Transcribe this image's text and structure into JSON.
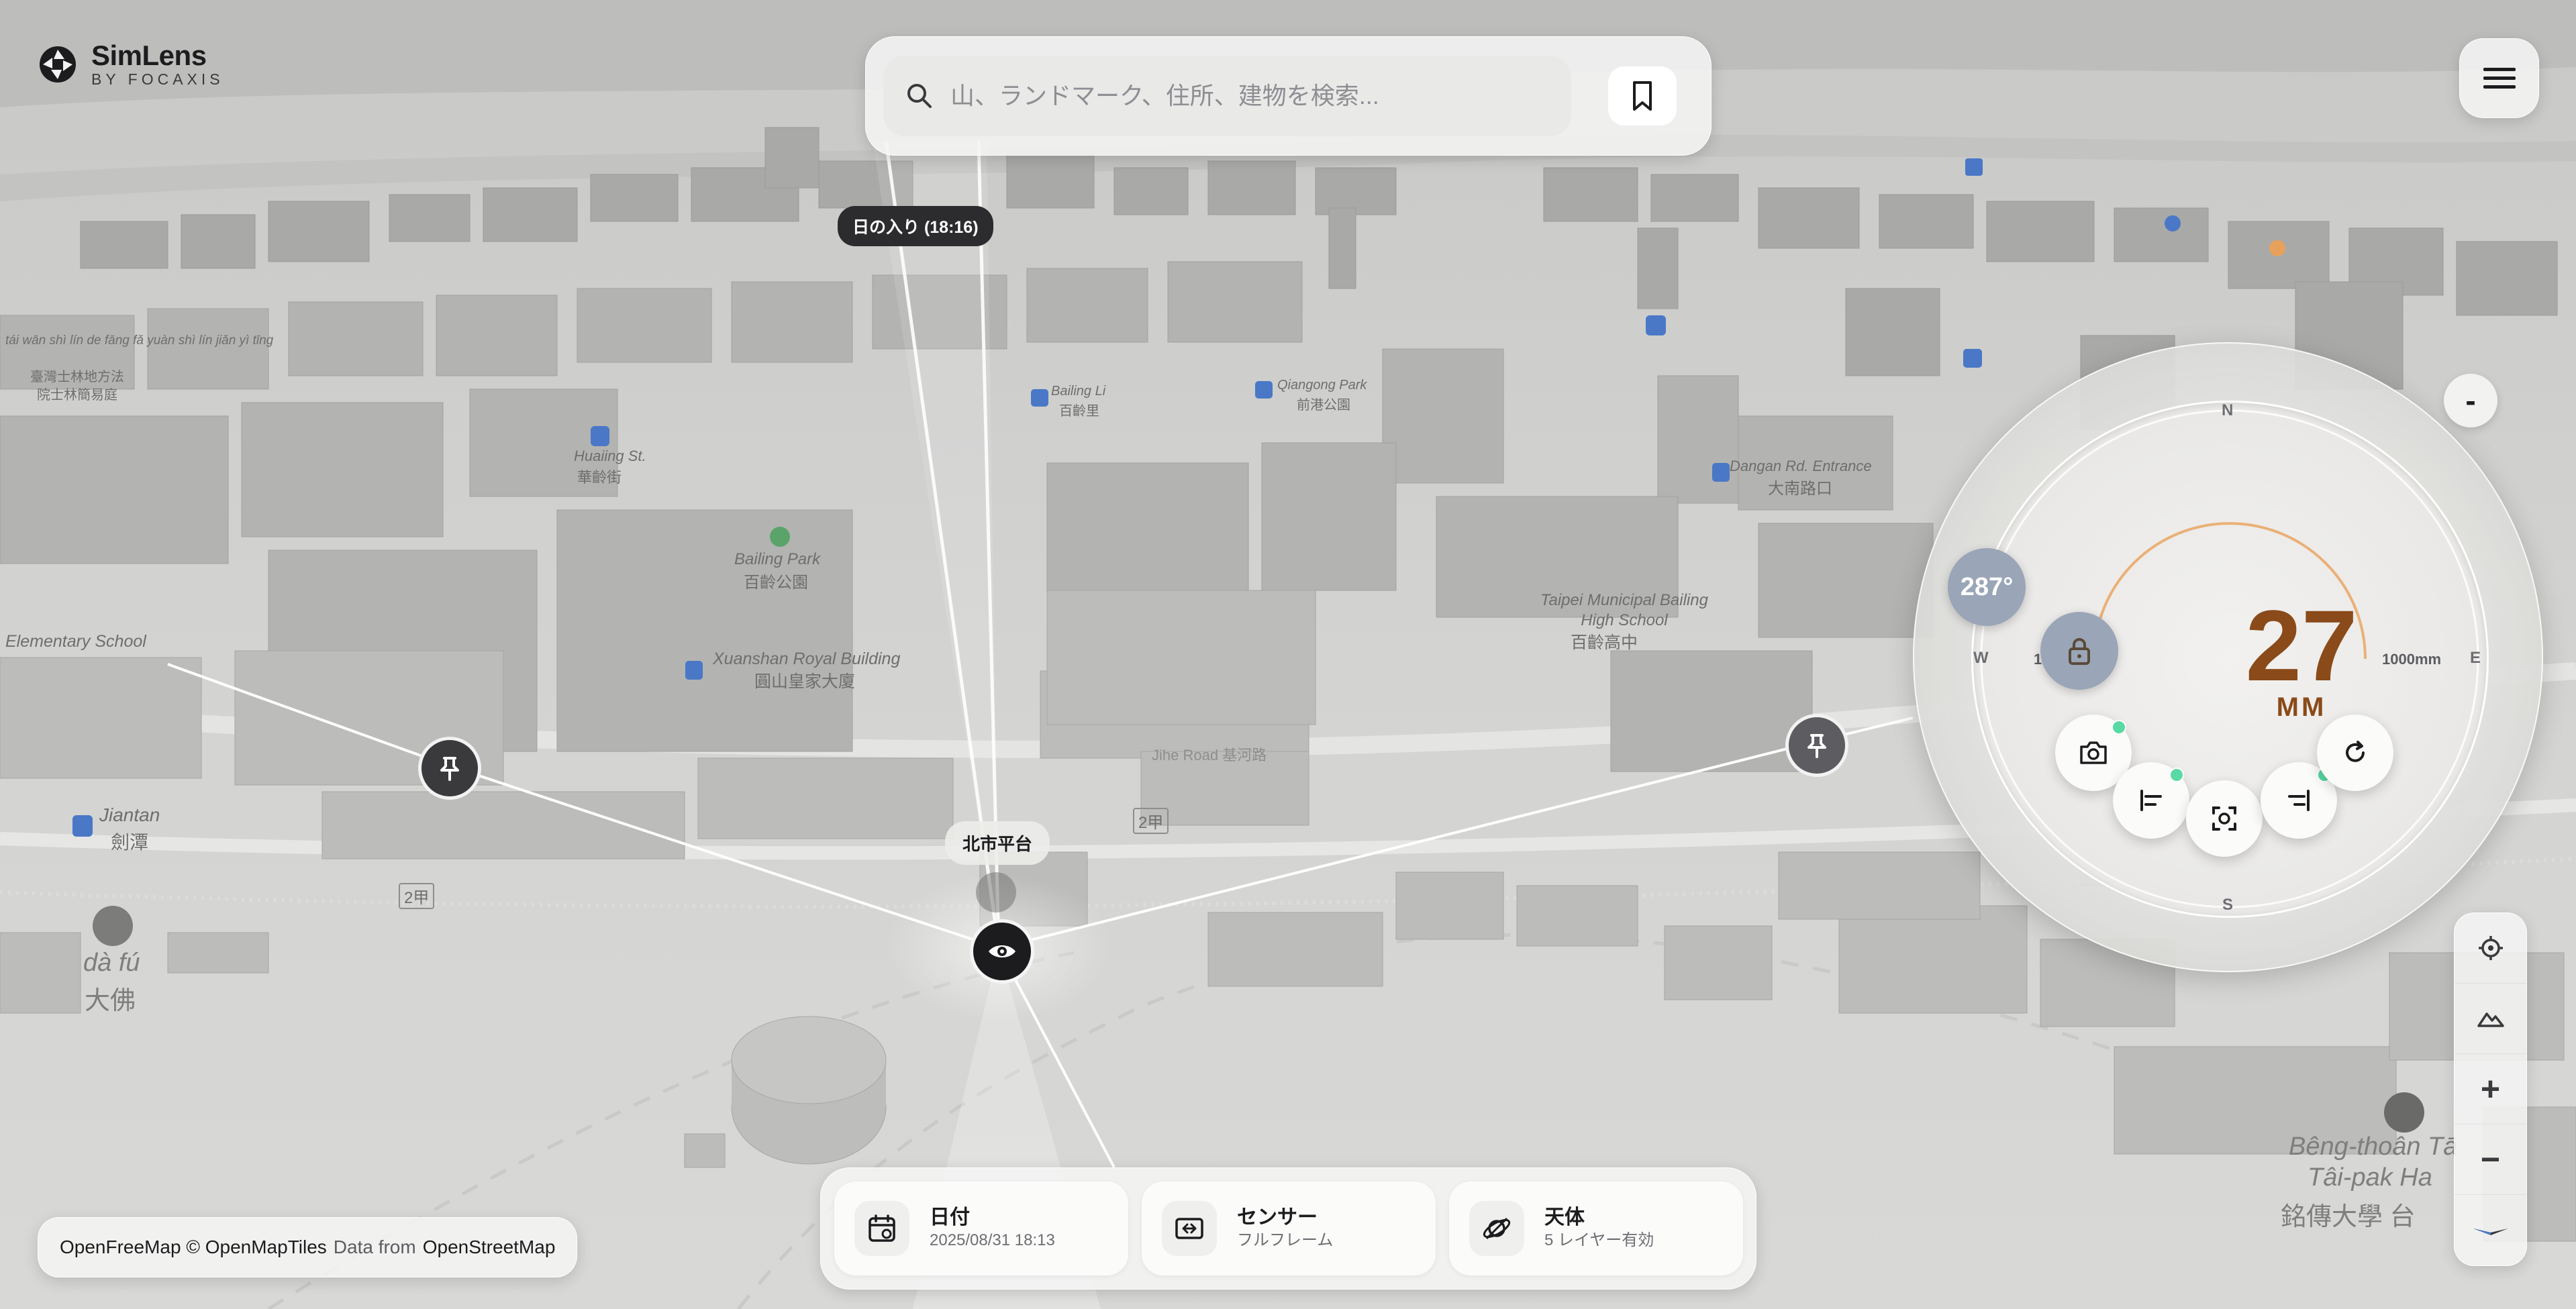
{
  "app": {
    "name": "SimLens",
    "byline": "BY FOCAXIS"
  },
  "search": {
    "placeholder": "山、ランドマーク、住所、建物を検索..."
  },
  "map_labels": {
    "sunset": "日の入り (18:16)",
    "viewpoint": "北市平台",
    "tianmu_station": "tái wān shì lín de fāng fǎ yuàn shì lín jiǎn yì tīng",
    "tianmu_station_cn": "臺灣士林地方法",
    "tianmu_station_cn2": "院士林簡易庭",
    "huaxing": "Huaiing St.",
    "huaxing_cn": "華齡街",
    "bailing_li": "Bailing Li",
    "bailing_li_cn": "百齡里",
    "qiangong": "Qiangong Park",
    "qiangong_cn": "前港公園",
    "bailing_park": "Bailing Park",
    "bailing_park_cn": "百齡公園",
    "xuanshan": "Xuanshan Royal Building",
    "xuanshan_cn": "圓山皇家大廈",
    "dangan": "Dangan Rd. Entrance",
    "dangan_cn": "大南路口",
    "school": "Taipei Municipal Bailing High School",
    "school_cn": "百齡高中",
    "jiantan": "Jiantan",
    "jiantan_cn": "劍潭",
    "dafu": "dà fú",
    "dafu_cn": "大佛",
    "ming_chuan": "Bêng-thoân Tā",
    "ming_chuan_2": "Tâi-pak Ha",
    "ming_chuan_cn": "銘傳大學 台",
    "elementary": "Elementary School",
    "road_2a": "2甲",
    "road_2b": "2甲",
    "xin_road": "Jihe Road 基河路"
  },
  "dial": {
    "north": "N",
    "south": "S",
    "west": "W",
    "east": "E",
    "heading": "287°",
    "focal_value": "27",
    "focal_unit": "MM",
    "range_min": "10",
    "range_max": "1000mm",
    "focal_fraction": 0.04,
    "collapse_label": "-"
  },
  "bottom": {
    "date_title": "日付",
    "date_value": "2025/08/31 18:13",
    "sensor_title": "センサー",
    "sensor_value": "フルフレーム",
    "celestial_title": "天体",
    "celestial_value": "5 レイヤー有効"
  },
  "attribution": {
    "part1": "OpenFreeMap © OpenMapTiles",
    "part2": "Data from",
    "part3": "OpenStreetMap"
  },
  "map_tools": {
    "zoom_in": "+",
    "zoom_out": "−"
  },
  "colors": {
    "accent_focal": "#8a4a1a",
    "arc": "#e8a15a",
    "badge": "#9aa5b7",
    "status_dot": "#59d9a4"
  }
}
